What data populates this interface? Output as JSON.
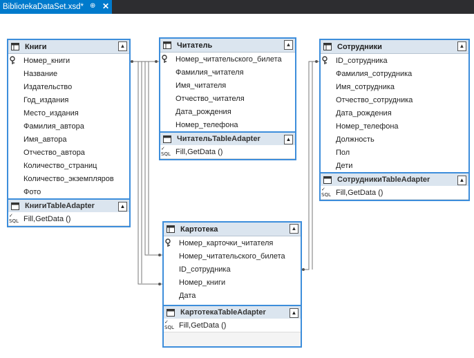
{
  "tab": {
    "title": "BibliotekaDataSet.xsd*",
    "pin": "⊕",
    "close": "✕"
  },
  "tables": {
    "knigi": {
      "name": "Книги",
      "columns": [
        "Номер_книги",
        "Название",
        "Издательство",
        "Год_издания",
        "Место_издания",
        "Фамилия_автора",
        "Имя_автора",
        "Отчество_автора",
        "Количество_страниц",
        "Количество_экземпляров",
        "Фото"
      ],
      "adapter": "КнигиTableAdapter",
      "method": "Fill,GetData ()"
    },
    "chitatel": {
      "name": "Читатель",
      "columns": [
        "Номер_читательского_билета",
        "Фамилия_читателя",
        "Имя_читателя",
        "Отчество_читателя",
        "Дата_рождения",
        "Номер_телефона"
      ],
      "adapter": "ЧитательTableAdapter",
      "method": "Fill,GetData ()"
    },
    "sotrudniki": {
      "name": "Сотрудники",
      "columns": [
        "ID_сотрудника",
        "Фамилия_сотрудника",
        "Имя_сотрудника",
        "Отчество_сотрудника",
        "Дата_рождения",
        "Номер_телефона",
        "Должность",
        "Пол",
        "Дети"
      ],
      "adapter": "СотрудникиTableAdapter",
      "method": "Fill,GetData ()"
    },
    "kartoteka": {
      "name": "Картотека",
      "columns": [
        "Номер_карточки_читателя",
        "Номер_читательского_билета",
        "ID_сотрудника",
        "Номер_книги",
        "Дата"
      ],
      "adapter": "КартотекаTableAdapter",
      "method": "Fill,GetData ()"
    }
  },
  "sql_label": "SQL",
  "colors": {
    "accent": "#007acc",
    "table_border": "#3c8ddb",
    "header_bg": "#dbe5ef"
  }
}
